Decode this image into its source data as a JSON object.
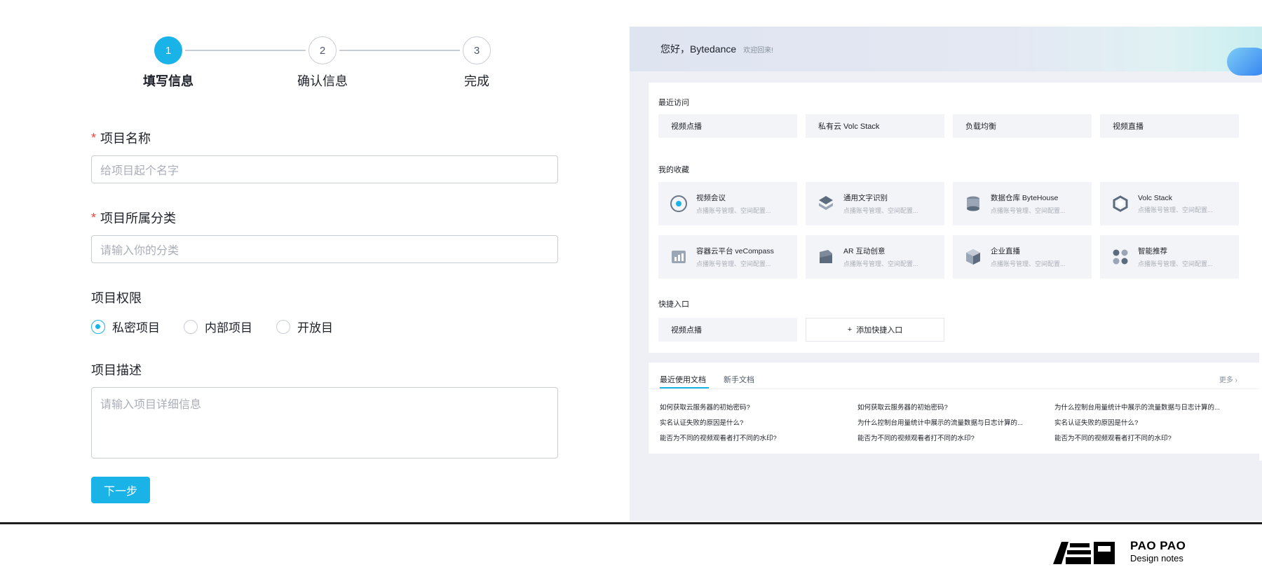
{
  "steps": [
    {
      "num": "1",
      "label": "填写信息"
    },
    {
      "num": "2",
      "label": "确认信息"
    },
    {
      "num": "3",
      "label": "完成"
    }
  ],
  "form": {
    "name": {
      "required_mark": "*",
      "label": "项目名称",
      "placeholder": "给项目起个名字"
    },
    "category": {
      "required_mark": "*",
      "label": "项目所属分类",
      "placeholder": "请输入你的分类"
    },
    "permission": {
      "label": "项目权限",
      "options": [
        "私密项目",
        "内部项目",
        "开放目"
      ],
      "selected": "私密项目"
    },
    "description": {
      "label": "项目描述",
      "placeholder": "请输入项目详细信息"
    },
    "next_label": "下一步"
  },
  "preview": {
    "greeting": "您好，Bytedance",
    "welcome": "欢迎回来!",
    "recent": {
      "title": "最近访问",
      "items": [
        "视频点播",
        "私有云 Volc Stack",
        "负载均衡",
        "视频直播"
      ]
    },
    "favorites": {
      "title": "我的收藏",
      "items": [
        {
          "title": "视频会议",
          "sub": "点播账号管理、空间配置..."
        },
        {
          "title": "通用文字识别",
          "sub": "点播账号管理、空间配置..."
        },
        {
          "title": "数据仓库 ByteHouse",
          "sub": "点播账号管理、空间配置..."
        },
        {
          "title": "Volc Stack",
          "sub": "点播账号管理、空间配置..."
        },
        {
          "title": "容器云平台 veCompass",
          "sub": "点播账号管理、空间配置..."
        },
        {
          "title": "AR 互动创意",
          "sub": "点播账号管理、空间配置..."
        },
        {
          "title": "企业直播",
          "sub": "点播账号管理、空间配置..."
        },
        {
          "title": "智能推荐",
          "sub": "点播账号管理、空间配置..."
        }
      ]
    },
    "shortcuts": {
      "title": "快捷入口",
      "items": [
        "视频点播"
      ],
      "add_label": "添加快捷入口",
      "add_icon": "+"
    },
    "docs": {
      "tabs": [
        "最近使用文档",
        "新手文档"
      ],
      "more": "更多 ›",
      "links": [
        [
          "如何获取云服务器的初始密码?",
          "实名认证失败的原因是什么?",
          "能否为不同的视频观看者打不同的水印?"
        ],
        [
          "如何获取云服务器的初始密码?",
          "为什么控制台用量统计中展示的流量数据与日志计算的...",
          "能否为不同的视频观看者打不同的水印?"
        ],
        [
          "为什么控制台用量统计中展示的流量数据与日志计算的...",
          "实名认证失败的原因是什么?",
          "能否为不同的视频观看者打不同的水印?"
        ]
      ]
    }
  },
  "watermark": {
    "brand": "PAO PAO",
    "tagline": "Design notes"
  },
  "colors": {
    "accent": "#1ab3e8",
    "required": "#f53f3f",
    "border": "#c9cdd4"
  }
}
